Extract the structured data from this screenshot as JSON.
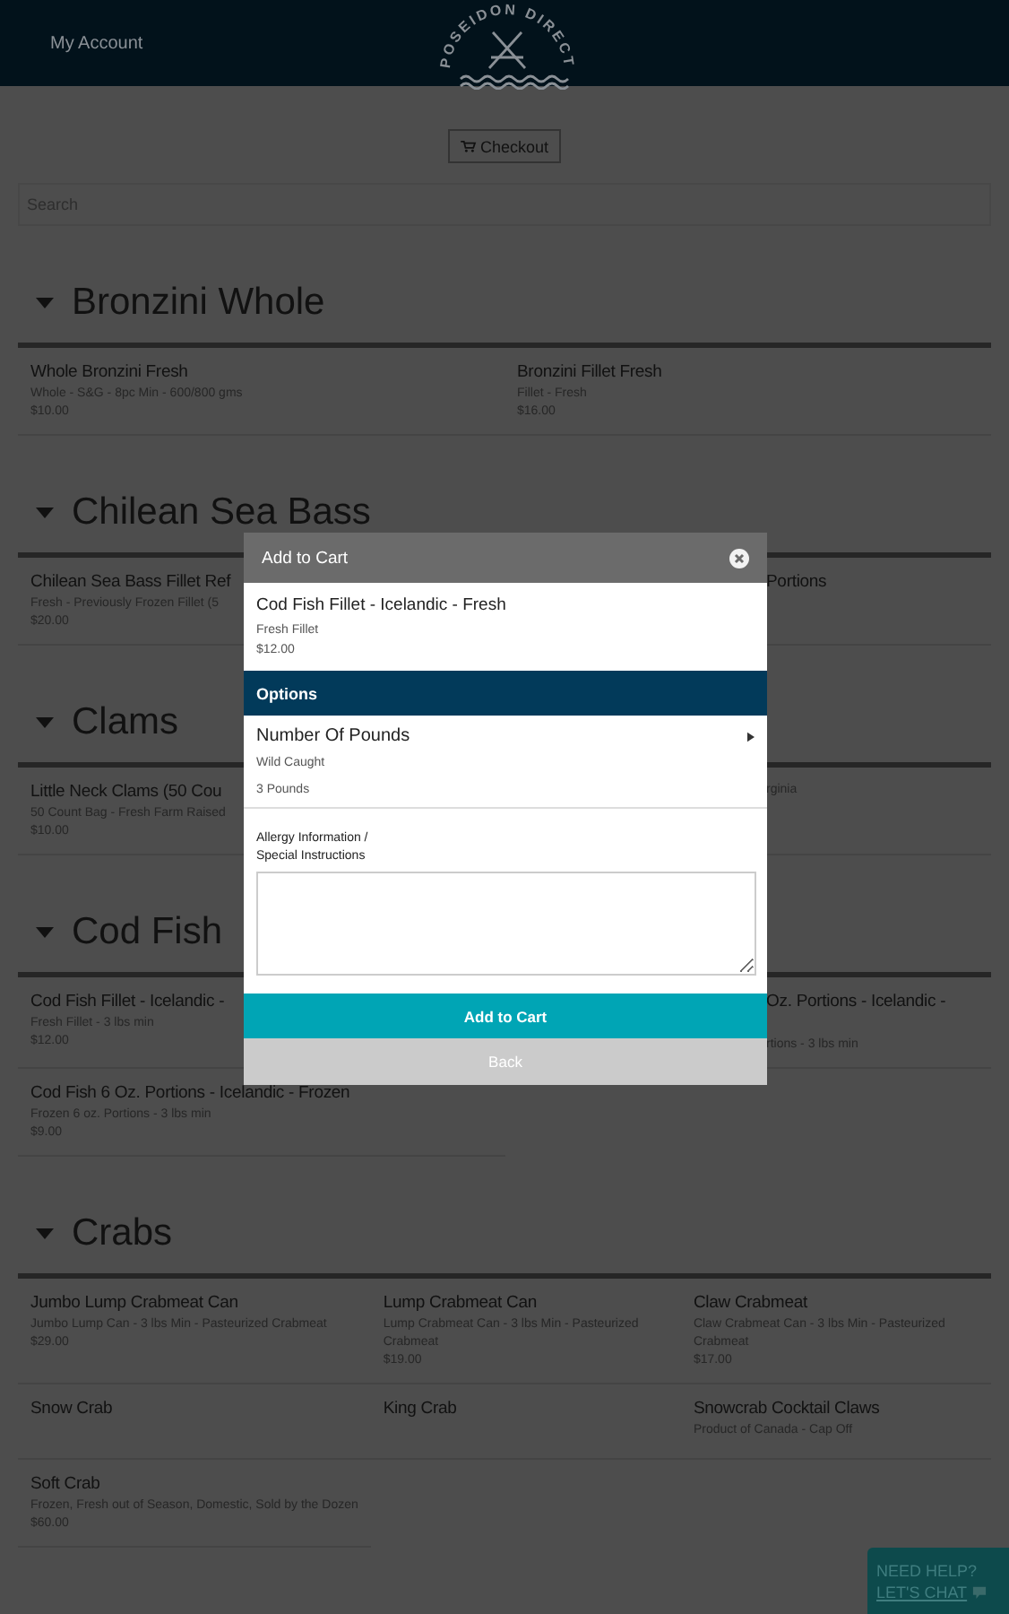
{
  "header": {
    "account_link": "My Account",
    "logo_text": "POSEIDON DIRECT"
  },
  "checkout_button": "Checkout",
  "search": {
    "placeholder": "Search"
  },
  "sections": [
    {
      "title": "Bronzini Whole",
      "expanded": true,
      "kind": "two_column",
      "items": [
        {
          "kind": "full",
          "name": "Whole Bronzini Fresh",
          "description": "Whole - S&G - 8pc Min - 600/800 gms",
          "price": "$10.00"
        },
        {
          "kind": "full",
          "name": "Bronzini Fillet Fresh",
          "description": "Fillet - Fresh",
          "price": "$16.00"
        }
      ]
    },
    {
      "title": "Chilean Sea Bass",
      "expanded": true,
      "kind": "two_column",
      "items": [
        {
          "kind": "full",
          "name": "Chilean Sea Bass Fillet Ref",
          "description": "Fresh - Previously Frozen Fillet (5",
          "price": "$20.00"
        },
        {
          "kind": "right_fragment",
          "name": "Portions"
        }
      ]
    },
    {
      "title": "Clams",
      "expanded": true,
      "kind": "two_column",
      "items": [
        {
          "kind": "full",
          "name": "Little Neck Clams (50 Cou",
          "description": "50 Count Bag - Fresh Farm Raised",
          "price": "$10.00"
        },
        {
          "kind": "right_fragment",
          "description": "rginia"
        }
      ]
    },
    {
      "title": "Cod Fish",
      "expanded": true,
      "kind": "two_column",
      "items": [
        {
          "kind": "full",
          "name": "Cod Fish Fillet - Icelandic -",
          "description": "Fresh Fillet - 3 lbs min",
          "price": "$12.00"
        },
        {
          "kind": "right_fragment",
          "name": "Oz. Portions - Icelandic -",
          "description": "rtions - 3 lbs min"
        },
        {
          "kind": "full",
          "name": "Cod Fish 6 Oz. Portions - Icelandic - Frozen",
          "description": "Frozen 6 oz. Portions - 3 lbs min",
          "price": "$9.00"
        }
      ]
    },
    {
      "title": "Crabs",
      "expanded": true,
      "kind": "three_column",
      "items": [
        {
          "kind": "full",
          "name": "Jumbo Lump Crabmeat Can",
          "description": "Jumbo Lump Can - 3 lbs Min - Pasteurized Crabmeat",
          "price": "$29.00"
        },
        {
          "kind": "full",
          "name": "Lump Crabmeat Can",
          "description": "Lump Crabmeat Can - 3 lbs Min - Pasteurized Crabmeat",
          "price": "$19.00"
        },
        {
          "kind": "full",
          "name": "Claw Crabmeat",
          "description": "Claw Crabmeat Can - 3 lbs Min - Pasteurized Crabmeat",
          "price": "$17.00"
        },
        {
          "kind": "full",
          "name": "Snow Crab"
        },
        {
          "kind": "full",
          "name": "King Crab"
        },
        {
          "kind": "full",
          "name": "Snowcrab Cocktail Claws",
          "description": "Product of Canada - Cap Off"
        },
        {
          "kind": "full",
          "name": "Soft Crab",
          "description": "Frozen, Fresh out of Season, Domestic, Sold by the Dozen",
          "price": "$60.00"
        }
      ]
    }
  ],
  "modal": {
    "title": "Add to Cart",
    "product": {
      "name": "Cod Fish Fillet - Icelandic - Fresh",
      "description": "Fresh Fillet",
      "price": "$12.00"
    },
    "options_heading": "Options",
    "options": [
      {
        "label": "Number Of Pounds",
        "subtitle": "Wild Caught",
        "value": "3 Pounds"
      }
    ],
    "instructions_label": [
      "Allergy Information /",
      "Special Instructions"
    ],
    "primary_button": "Add to Cart",
    "secondary_button": "Back"
  },
  "chat_widget": {
    "line_1": "NEED HELP?",
    "line_2": "LET'S CHAT"
  }
}
